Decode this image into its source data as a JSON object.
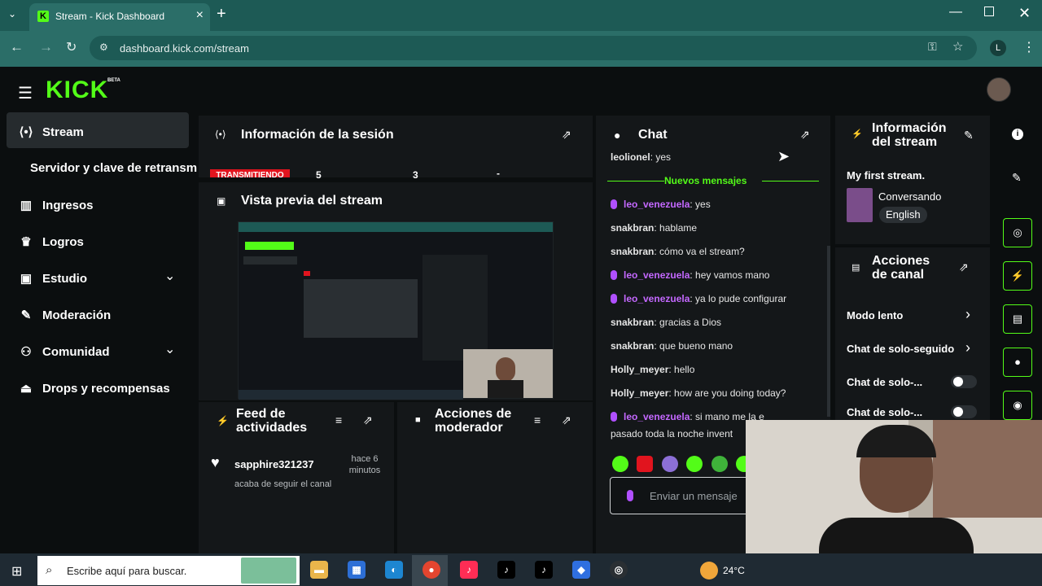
{
  "browser": {
    "tab_title": "Stream - Kick Dashboard",
    "tab_favicon": "K",
    "url": "dashboard.kick.com/stream",
    "profile_letter": "L"
  },
  "app": {
    "logo": "KICK",
    "logo_badge": "BETA"
  },
  "sidebar": {
    "items": [
      {
        "label": "Stream",
        "icon": "broadcast-icon",
        "active": true
      },
      {
        "label": "Servidor y clave de retransm",
        "icon": "",
        "active": false
      },
      {
        "label": "Ingresos",
        "icon": "chart-icon",
        "active": false
      },
      {
        "label": "Logros",
        "icon": "trophy-icon",
        "active": false
      },
      {
        "label": "Estudio",
        "icon": "studio-icon",
        "active": false,
        "expandable": true
      },
      {
        "label": "Moderación",
        "icon": "wrench-icon",
        "active": false
      },
      {
        "label": "Comunidad",
        "icon": "community-icon",
        "active": false,
        "expandable": true
      },
      {
        "label": "Drops y recompensas",
        "icon": "drops-icon",
        "active": false
      }
    ]
  },
  "session": {
    "title": "Información de la sesión",
    "status": "TRANSMITIENDO",
    "stat1": "5",
    "stat2": "3",
    "stat3": "-"
  },
  "preview": {
    "title": "Vista previa del stream"
  },
  "feed": {
    "title": "Feed de actividades",
    "items": [
      {
        "user": "sapphire321237",
        "time": "hace 6 minutos",
        "text": "acaba de seguir el canal"
      }
    ]
  },
  "mod_actions": {
    "title": "Acciones de moderador"
  },
  "chat": {
    "title": "Chat",
    "new_messages": "Nuevos mensajes",
    "top_partial": {
      "user": "leolionel",
      "text": ": yes"
    },
    "messages": [
      {
        "user": "leo_venezuela",
        "text": ": yes",
        "style": "purple"
      },
      {
        "user": "snakbran",
        "text": ": hablame",
        "style": "gray"
      },
      {
        "user": "snakbran",
        "text": ": cómo va el stream?",
        "style": "gray"
      },
      {
        "user": "leo_venezuela",
        "text": ": hey vamos mano",
        "style": "purple"
      },
      {
        "user": "leo_venezuela",
        "text": ": ya lo pude configurar",
        "style": "purple"
      },
      {
        "user": "snakbran",
        "text": ": gracias a Dios",
        "style": "gray"
      },
      {
        "user": "snakbran",
        "text": ": que bueno mano",
        "style": "gray"
      },
      {
        "user": "Holly_meyer",
        "text": ": hello",
        "style": "gray"
      },
      {
        "user": "Holly_meyer",
        "text": ": how are you doing today?",
        "style": "gray"
      },
      {
        "user": "leo_venezuela",
        "text": ": si mano me la e",
        "style": "purple"
      }
    ],
    "last_wrap": "pasado toda la noche invent",
    "input_placeholder": "Enviar un mensaje"
  },
  "stream_info": {
    "title": "Información del stream",
    "stream_title": "My first stream.",
    "category": "Conversando",
    "language": "English"
  },
  "channel_actions": {
    "title": "Acciones de canal",
    "items": [
      {
        "label": "Modo lento",
        "type": "chevron"
      },
      {
        "label": "Chat de solo-seguido",
        "type": "chevron"
      },
      {
        "label": "Chat de solo-...",
        "type": "toggle"
      },
      {
        "label": "Chat de solo-...",
        "type": "toggle"
      }
    ]
  },
  "taskbar": {
    "search_placeholder": "Escribe aquí para buscar.",
    "weather": "24°C"
  },
  "colors": {
    "accent": "#53fc18",
    "live_badge": "#e1141e",
    "chat_purple": "#c468ff",
    "chrome": "#1d5a55"
  }
}
